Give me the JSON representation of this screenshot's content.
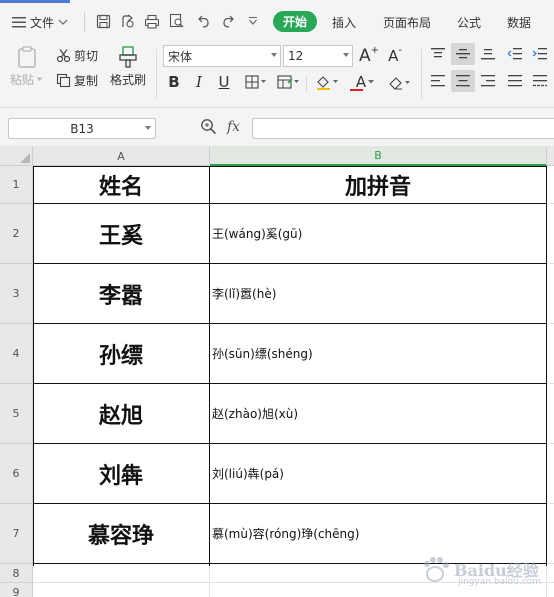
{
  "menubar": {
    "file_label": "文件",
    "tabs": [
      {
        "label": "开始",
        "active": true
      },
      {
        "label": "插入",
        "active": false
      },
      {
        "label": "页面布局",
        "active": false
      },
      {
        "label": "公式",
        "active": false
      },
      {
        "label": "数据",
        "active": false
      }
    ]
  },
  "ribbon": {
    "paste_label": "粘贴",
    "cut_label": "剪切",
    "copy_label": "复制",
    "format_painter_label": "格式刷",
    "font_name": "宋体",
    "font_size": "12",
    "bold": "B",
    "italic": "I",
    "underline": "U",
    "font_color_letter": "A",
    "grow_font": "A",
    "shrink_font": "A"
  },
  "formula_bar": {
    "name_box": "B13",
    "fx_label": "fx",
    "formula_value": ""
  },
  "sheet": {
    "columns": [
      "A",
      "B"
    ],
    "selected_column": "B",
    "row_numbers": [
      "1",
      "2",
      "3",
      "4",
      "5",
      "6",
      "7",
      "8",
      "9"
    ],
    "header": {
      "a": "姓名",
      "b": "加拼音"
    },
    "rows": [
      {
        "name": "王奚",
        "pinyin": "王(wáng)奚(gū)"
      },
      {
        "name": "李嚣",
        "pinyin": "李(lǐ)嚣(hè)"
      },
      {
        "name": "孙缥",
        "pinyin": "孙(sūn)缥(shéng)"
      },
      {
        "name": "赵旭",
        "pinyin": "赵(zhào)旭(xù)"
      },
      {
        "name": "刘犇",
        "pinyin": "刘(liú)犇(pá)"
      },
      {
        "name": "慕容琤",
        "pinyin": "慕(mù)容(róng)琤(chēng)"
      }
    ]
  },
  "watermark": {
    "text": "Baidu经验",
    "sub": "jingyan.baidu.com"
  },
  "colors": {
    "accent_green": "#29a957",
    "ribbon_bg": "#f3f4f6",
    "selected_col": "#2f9e4f"
  }
}
